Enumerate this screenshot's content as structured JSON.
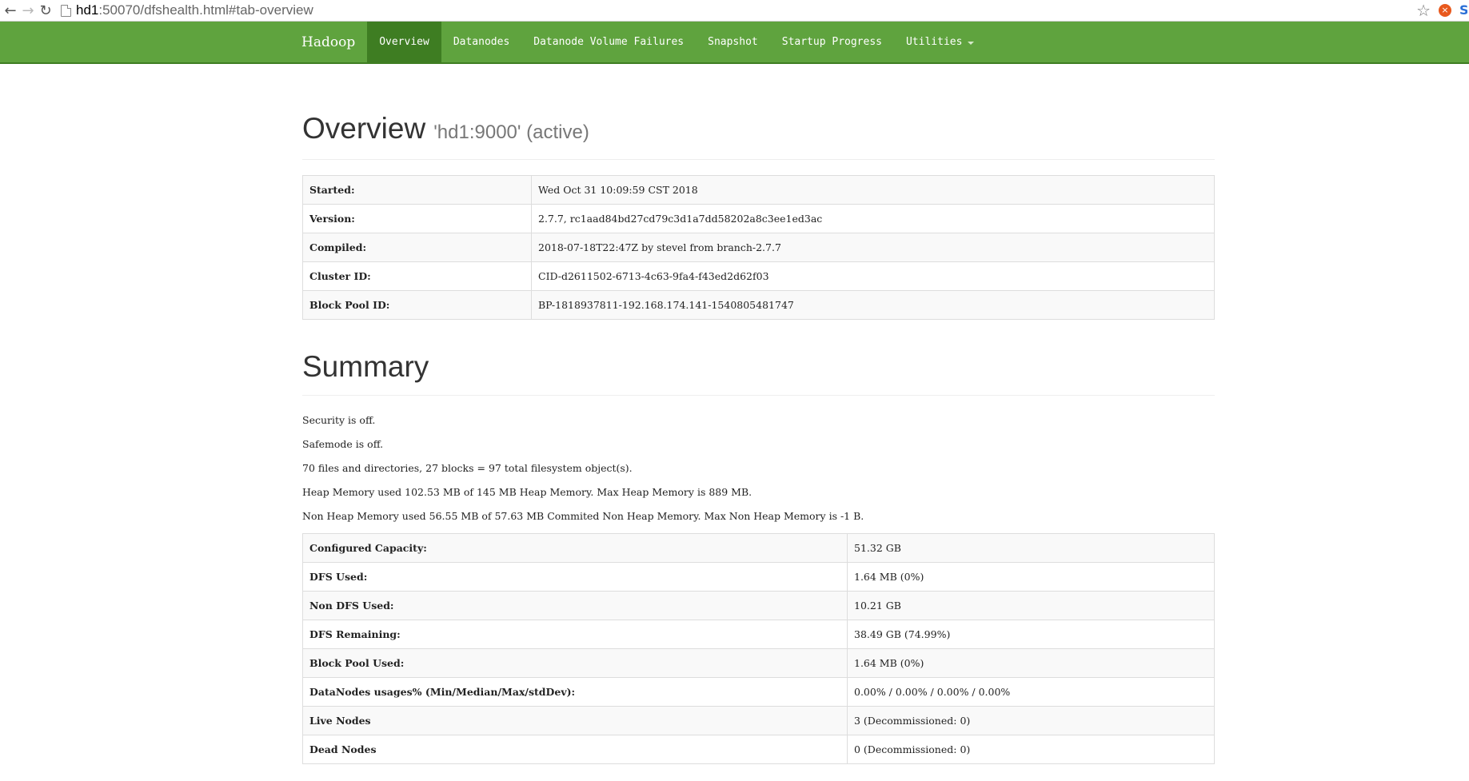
{
  "browser": {
    "url_host": "hd1",
    "url_rest": ":50070/dfshealth.html#tab-overview"
  },
  "navbar": {
    "brand": "Hadoop",
    "items": [
      {
        "label": "Overview",
        "active": true
      },
      {
        "label": "Datanodes",
        "active": false
      },
      {
        "label": "Datanode Volume Failures",
        "active": false
      },
      {
        "label": "Snapshot",
        "active": false
      },
      {
        "label": "Startup Progress",
        "active": false
      },
      {
        "label": "Utilities",
        "active": false,
        "dropdown": true
      }
    ],
    "colors": {
      "bar": "#5fa33e",
      "active": "#3e7d22"
    }
  },
  "overview": {
    "title": "Overview",
    "subtitle": "'hd1:9000' (active)",
    "rows": [
      {
        "key": "Started:",
        "value": "Wed Oct 31 10:09:59 CST 2018"
      },
      {
        "key": "Version:",
        "value": "2.7.7, rc1aad84bd27cd79c3d1a7dd58202a8c3ee1ed3ac"
      },
      {
        "key": "Compiled:",
        "value": "2018-07-18T22:47Z by stevel from branch-2.7.7"
      },
      {
        "key": "Cluster ID:",
        "value": "CID-d2611502-6713-4c63-9fa4-f43ed2d62f03"
      },
      {
        "key": "Block Pool ID:",
        "value": "BP-1818937811-192.168.174.141-1540805481747"
      }
    ]
  },
  "summary": {
    "title": "Summary",
    "lines": [
      "Security is off.",
      "Safemode is off.",
      "70 files and directories, 27 blocks = 97 total filesystem object(s).",
      "Heap Memory used 102.53 MB of 145 MB Heap Memory. Max Heap Memory is 889 MB.",
      "Non Heap Memory used 56.55 MB of 57.63 MB Commited Non Heap Memory. Max Non Heap Memory is -1 B."
    ],
    "rows": [
      {
        "key": "Configured Capacity:",
        "value": "51.32 GB"
      },
      {
        "key": "DFS Used:",
        "value": "1.64 MB (0%)"
      },
      {
        "key": "Non DFS Used:",
        "value": "10.21 GB"
      },
      {
        "key": "DFS Remaining:",
        "value": "38.49 GB (74.99%)"
      },
      {
        "key": "Block Pool Used:",
        "value": "1.64 MB (0%)"
      },
      {
        "key": "DataNodes usages% (Min/Median/Max/stdDev):",
        "value": "0.00% / 0.00% / 0.00% / 0.00%"
      },
      {
        "key": "Live Nodes",
        "value": "3 (Decommissioned: 0)",
        "link": true
      },
      {
        "key": "Dead Nodes",
        "value": "0 (Decommissioned: 0)",
        "link": true
      }
    ]
  }
}
